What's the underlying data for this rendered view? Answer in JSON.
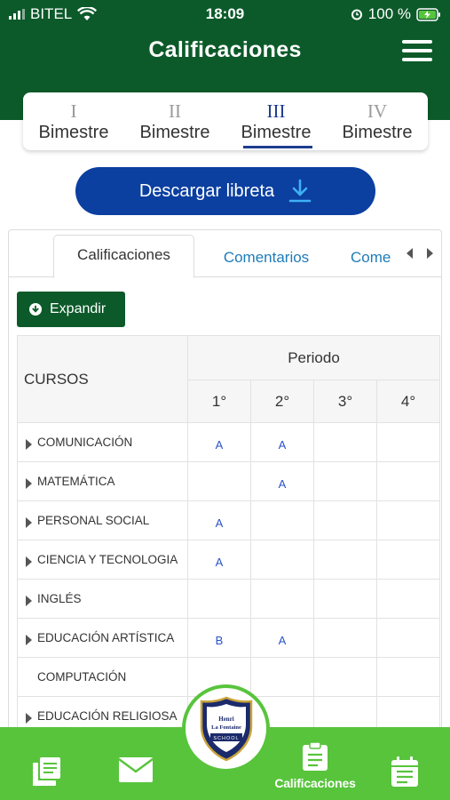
{
  "status_bar": {
    "carrier": "BITEL",
    "time": "18:09",
    "battery": "100 %"
  },
  "header": {
    "title": "Calificaciones"
  },
  "bimestres": [
    {
      "roman": "I",
      "label": "Bimestre",
      "active": false
    },
    {
      "roman": "II",
      "label": "Bimestre",
      "active": false
    },
    {
      "roman": "III",
      "label": "Bimestre",
      "active": true
    },
    {
      "roman": "IV",
      "label": "Bimestre",
      "active": false
    }
  ],
  "download_button": {
    "label": "Descargar libreta"
  },
  "tabs": [
    {
      "label": "Calificaciones"
    },
    {
      "label": "Comentarios"
    },
    {
      "label": "Come"
    }
  ],
  "expand_button": {
    "label": "Expandir"
  },
  "table": {
    "cursos_header": "CURSOS",
    "periodo_header": "Periodo",
    "periods": [
      "1°",
      "2°",
      "3°",
      "4°"
    ],
    "rows": [
      {
        "course": "COMUNICACIÓN",
        "expandable": true,
        "grades": [
          "A",
          "A",
          "",
          ""
        ]
      },
      {
        "course": "MATEMÁTICA",
        "expandable": true,
        "grades": [
          "",
          "A",
          "",
          ""
        ]
      },
      {
        "course": "PERSONAL SOCIAL",
        "expandable": true,
        "grades": [
          "A",
          "",
          "",
          ""
        ]
      },
      {
        "course": "CIENCIA Y TECNOLOGIA",
        "expandable": true,
        "grades": [
          "A",
          "",
          "",
          ""
        ]
      },
      {
        "course": "INGLÉS",
        "expandable": true,
        "grades": [
          "",
          "",
          "",
          ""
        ]
      },
      {
        "course": "EDUCACIÓN ARTÍSTICA",
        "expandable": true,
        "grades": [
          "B",
          "A",
          "",
          ""
        ]
      },
      {
        "course": "COMPUTACIÓN",
        "expandable": false,
        "grades": [
          "",
          "",
          "",
          ""
        ]
      },
      {
        "course": "EDUCACIÓN RELIGIOSA",
        "expandable": true,
        "grades": [
          "",
          "",
          "",
          ""
        ]
      }
    ]
  },
  "bottom_nav": {
    "active_label": "Calificaciones",
    "logo_text": {
      "line1": "Henri",
      "line2": "La Fontaine",
      "line3": "SCHOOL"
    },
    "icons": [
      "notes-icon",
      "mail-icon",
      "clipboard-icon",
      "calendar-icon"
    ]
  },
  "colors": {
    "header_green": "#0c5a2a",
    "nav_green": "#58c43c",
    "primary_blue": "#0b3fa0",
    "active_blue": "#1e3d8f",
    "link_blue": "#1e7cb8",
    "grade_blue": "#2a52c9"
  }
}
